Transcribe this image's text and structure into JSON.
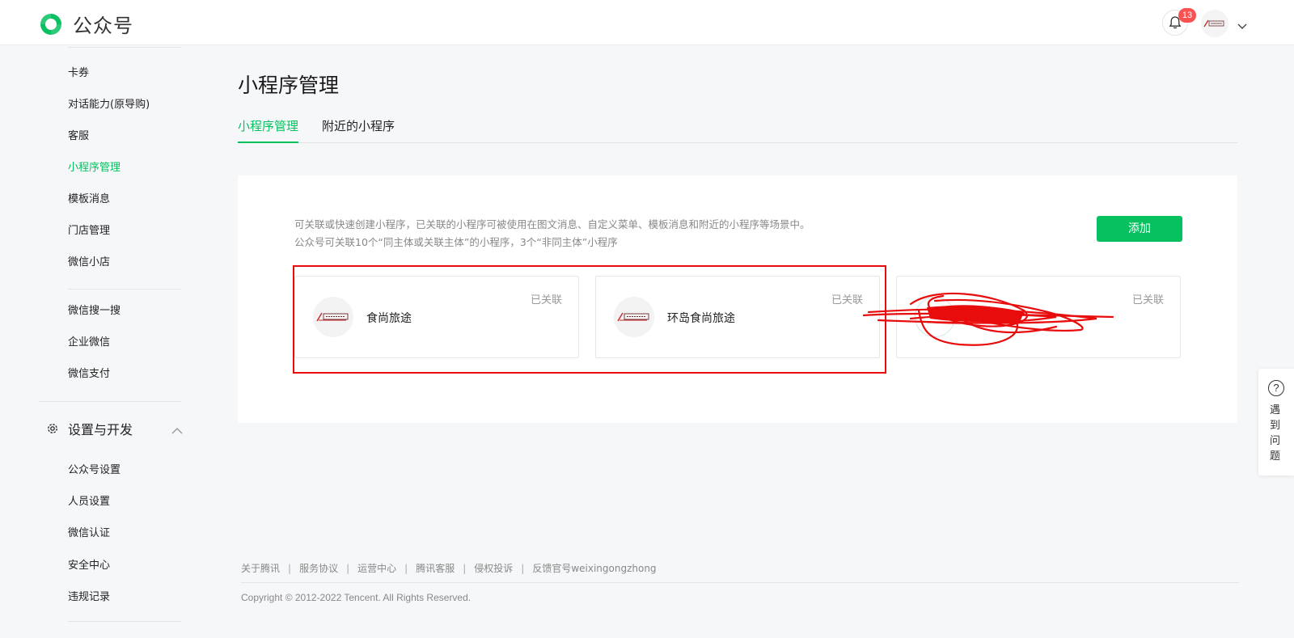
{
  "header": {
    "app_name": "公众号",
    "notification_count": "13",
    "brand_color": "#07c160",
    "badge_color": "#fa5151"
  },
  "sidebar": {
    "items": [
      {
        "label": "卡券"
      },
      {
        "label": "对话能力(原导购)"
      },
      {
        "label": "客服"
      },
      {
        "label": "小程序管理",
        "active": true
      },
      {
        "label": "模板消息"
      },
      {
        "label": "门店管理"
      },
      {
        "label": "微信小店"
      },
      {
        "label": "微信搜一搜"
      },
      {
        "label": "企业微信"
      },
      {
        "label": "微信支付"
      }
    ],
    "section": {
      "title": "设置与开发",
      "icon": "gear-icon",
      "items": [
        {
          "label": "公众号设置"
        },
        {
          "label": "人员设置"
        },
        {
          "label": "微信认证"
        },
        {
          "label": "安全中心"
        },
        {
          "label": "违规记录"
        }
      ]
    }
  },
  "main": {
    "title": "小程序管理",
    "tabs": [
      {
        "label": "小程序管理",
        "active": true
      },
      {
        "label": "附近的小程序",
        "active": false
      }
    ],
    "description": [
      "可关联或快速创建小程序，已关联的小程序可被使用在图文消息、自定义菜单、模板消息和附近的小程序等场景中。",
      "公众号可关联10个“同主体或关联主体”的小程序，3个“非同主体”小程序"
    ],
    "add_button": "添加",
    "cards": [
      {
        "status": "已关联",
        "name": "食尚旅途"
      },
      {
        "status": "已关联",
        "name": "环岛食尚旅途"
      },
      {
        "status": "已关联",
        "name": ""
      }
    ]
  },
  "footer": {
    "links": [
      "关于腾讯",
      "服务协议",
      "运营中心",
      "腾讯客服",
      "侵权投诉",
      "反馈官号weixingongzhong"
    ],
    "separator": "|",
    "copyright": "Copyright © 2012-2022 Tencent. All Rights Reserved."
  },
  "help": {
    "icon": "question-circle-icon",
    "label": "遇到问题"
  },
  "annotation": {
    "color": "#e80c0c"
  }
}
